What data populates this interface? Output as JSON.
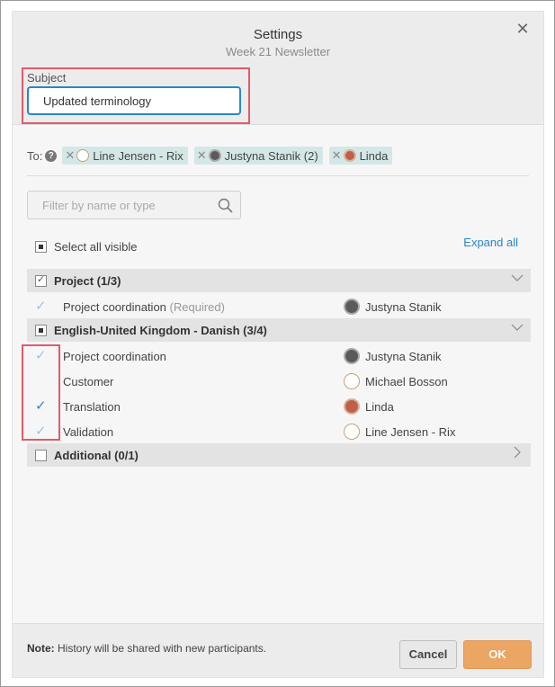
{
  "dialog": {
    "title": "Settings",
    "subtitle": "Week 21 Newsletter",
    "close_icon": "close-icon"
  },
  "subject": {
    "label": "Subject",
    "value": "Updated terminology"
  },
  "recipients": {
    "label": "To:",
    "help_icon": "question-circle-icon",
    "chips": [
      {
        "name": "Line Jensen - Rix",
        "avatar": "outline-avatar"
      },
      {
        "name": "Justyna Stanik (2)",
        "avatar": "photo-avatar"
      },
      {
        "name": "Linda",
        "avatar": "photo-avatar"
      }
    ]
  },
  "filter": {
    "placeholder": "Filter by name or type",
    "icon": "search-icon"
  },
  "select_all": {
    "label": "Select all visible",
    "state": "partial"
  },
  "expand_all": "Expand all",
  "groups": [
    {
      "title": "Project (1/3)",
      "state": "checked",
      "expanded": true,
      "rows": [
        {
          "task": "Project coordination",
          "note": "(Required)",
          "checked": true,
          "assignee": "Justyna Stanik",
          "avatar": "photo-avatar"
        }
      ]
    },
    {
      "title": "English-United Kingdom - Danish (3/4)",
      "state": "partial",
      "expanded": true,
      "rows": [
        {
          "task": "Project coordination",
          "note": "",
          "checked": true,
          "assignee": "Justyna Stanik",
          "avatar": "photo-avatar"
        },
        {
          "task": "Customer",
          "note": "",
          "checked": false,
          "assignee": "Michael Bosson",
          "avatar": "outline-avatar"
        },
        {
          "task": "Translation",
          "note": "",
          "checked": true,
          "assignee": "Linda",
          "avatar": "photo-avatar"
        },
        {
          "task": "Validation",
          "note": "",
          "checked": true,
          "assignee": "Line Jensen - Rix",
          "avatar": "outline-avatar"
        }
      ]
    },
    {
      "title": "Additional (0/1)",
      "state": "unchecked",
      "expanded": false,
      "rows": []
    }
  ],
  "footer": {
    "note_bold": "Note:",
    "note_text": " History will be shared with new participants.",
    "cancel_label": "Cancel",
    "ok_label": "OK"
  },
  "colors": {
    "accent": "#2a86c6",
    "ok_button": "#eba663",
    "chip_bg": "#d3e8e6",
    "highlight": "#e05a6a",
    "check_active": "#2a86c6",
    "check_faded": "#9cc6e3"
  }
}
